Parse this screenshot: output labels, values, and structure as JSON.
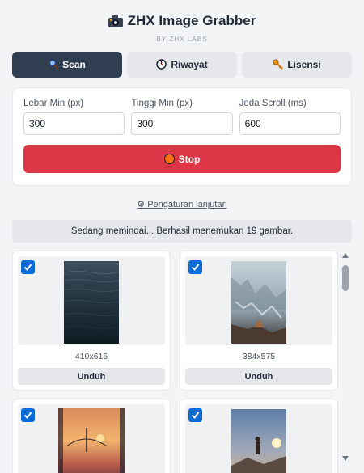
{
  "app": {
    "title": "ZHX Image Grabber",
    "subtitle": "BY ZHX LABS",
    "icon": "camera-icon"
  },
  "tabs": [
    {
      "label": "Scan",
      "icon": "magnifier-icon",
      "active": true
    },
    {
      "label": "Riwayat",
      "icon": "clock-icon",
      "active": false
    },
    {
      "label": "Lisensi",
      "icon": "key-icon",
      "active": false
    }
  ],
  "settings": {
    "min_width": {
      "label": "Lebar Min (px)",
      "value": "300"
    },
    "min_height": {
      "label": "Tinggi Min (px)",
      "value": "300"
    },
    "scroll_delay": {
      "label": "Jeda Scroll (ms)",
      "value": "600"
    },
    "stop_label": "Stop",
    "stop_icon": "red-circle-icon"
  },
  "advanced_link": "⚙ Pengaturan lanjutan",
  "status": "Sedang memindai... Berhasil menemukan 19 gambar.",
  "images": [
    {
      "dimensions": "410x615",
      "download_label": "Unduh",
      "checked": true
    },
    {
      "dimensions": "384x575",
      "download_label": "Unduh",
      "checked": true
    },
    {
      "checked": true
    },
    {
      "checked": true
    }
  ],
  "colors": {
    "accent_dark": "#2f3e50",
    "stop_red": "#dc3545",
    "checkbox_blue": "#0b6cd8"
  }
}
